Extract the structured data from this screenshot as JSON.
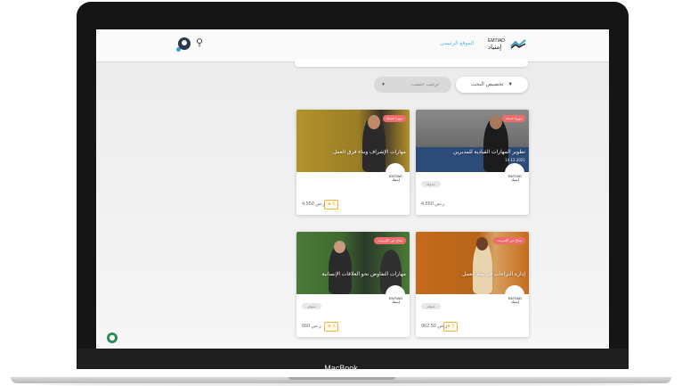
{
  "header": {
    "site_link": "الموقع الرئيسي",
    "logo_text": "EMTIAD"
  },
  "filters": {
    "filter_button": "تخصيص البحث",
    "sort_placeholder": "ترتيب حسب"
  },
  "courses": [
    {
      "tag": "دورة حديثة",
      "title": "مهارات الإشراف وبناء فرق العمل",
      "rating": "5",
      "price": "4,550 ر.س"
    },
    {
      "tag": "دورة حديثة",
      "title": "تطوير المهارات القيادية للمديرين",
      "date": "14.12.2021",
      "pill": "جدولة",
      "price": "4,550 ر.س"
    },
    {
      "tag": "متاح عن الإنترنت",
      "title": "مهارات التفاوض نحو العلاقات الإنسانية",
      "pill": "متوفر",
      "rating": "3",
      "price": "660 ر.س"
    },
    {
      "tag": "متاح عن الإنترنت",
      "title": "إدارة النزاعات في بيئة العمل",
      "pill": "متوفر",
      "rating": "5",
      "price": "962.50 ر.س"
    }
  ],
  "device": {
    "brand": "MacBook"
  }
}
